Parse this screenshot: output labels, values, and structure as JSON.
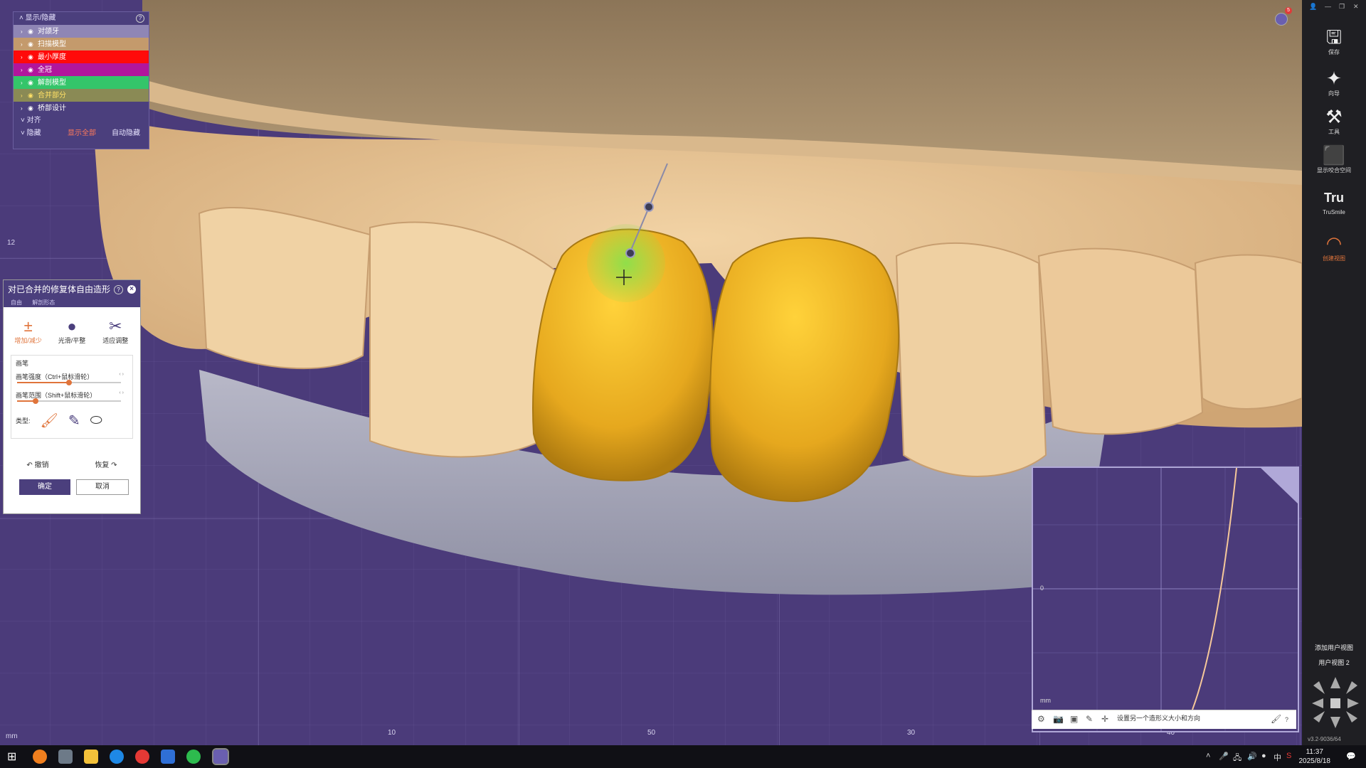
{
  "display_panel": {
    "header": "显示/隐藏",
    "help": "?",
    "layers": [
      {
        "label": "对颌牙",
        "bg": "#8f86b5",
        "color": "#ffffff"
      },
      {
        "label": "扫描模型",
        "bg": "#c49a6c",
        "color": "#ffffff"
      },
      {
        "label": "最小厚度",
        "bg": "#ff0a0a",
        "color": "#ffffff"
      },
      {
        "label": "全冠",
        "bg": "#b2169c",
        "color": "#ffffff"
      },
      {
        "label": "解剖模型",
        "bg": "#34c56a",
        "color": "#ffffff"
      },
      {
        "label": "合并部分",
        "bg": "#8a8a55",
        "color": "#ffe066"
      },
      {
        "label": "桥部设计",
        "bg": "#4b3f7d",
        "color": "#ffffff"
      }
    ],
    "section_label": "对齐",
    "hide_label": "隐藏",
    "show_all": "显示全部",
    "auto_hide": "自动隐藏"
  },
  "tool_panel": {
    "title": "对已合并的修复体自由造形",
    "help": "?",
    "close": "×",
    "tabs": [
      "自由",
      "解剖形态"
    ],
    "tools": [
      {
        "label": "增加/减少",
        "icon": "add-remove-icon",
        "active": true
      },
      {
        "label": "光滑/平整",
        "icon": "smooth-drop-icon",
        "active": false
      },
      {
        "label": "适应调整",
        "icon": "adapt-icon",
        "active": false
      }
    ],
    "brush_title": "画笔",
    "strength_label": "画笔强度（Ctrl+鼠标滑轮）",
    "strength_value": 50,
    "radius_label": "画笔范围（Shift+鼠标滑轮）",
    "radius_value": 18,
    "type_label": "类型:",
    "undo": "撤销",
    "redo": "恢复",
    "ok": "确定",
    "cancel": "取消"
  },
  "right_bar": {
    "items": [
      {
        "label": "保存",
        "icon": "save-icon",
        "glyph": "🖫"
      },
      {
        "label": "向导",
        "icon": "wizard-icon",
        "glyph": "✦"
      },
      {
        "label": "工具",
        "icon": "tools-icon",
        "glyph": "⚒"
      },
      {
        "label": "显示咬合空间",
        "icon": "occlusion-icon",
        "glyph": "⬛"
      },
      {
        "label": "TruSmile",
        "icon": "trusmile-icon",
        "glyph": "Tru"
      },
      {
        "label": "创建视图",
        "icon": "view-create-icon",
        "glyph": "◠"
      }
    ],
    "add_view": "添加用户视图",
    "user_view": "用户视图 2",
    "version": "v3.2-9036/64",
    "notification_count": "5"
  },
  "viewport": {
    "axis_labels": [
      "10",
      "50",
      "30",
      "40",
      "mm",
      "12"
    ],
    "crosshair": "+"
  },
  "mini_view": {
    "axis_zero": "0",
    "axis_unit": "mm",
    "hint": "设置另一个造形义大小和方向",
    "help": "?"
  },
  "taskbar": {
    "time": "11:37",
    "date": "2025/8/18",
    "ime": "中"
  }
}
